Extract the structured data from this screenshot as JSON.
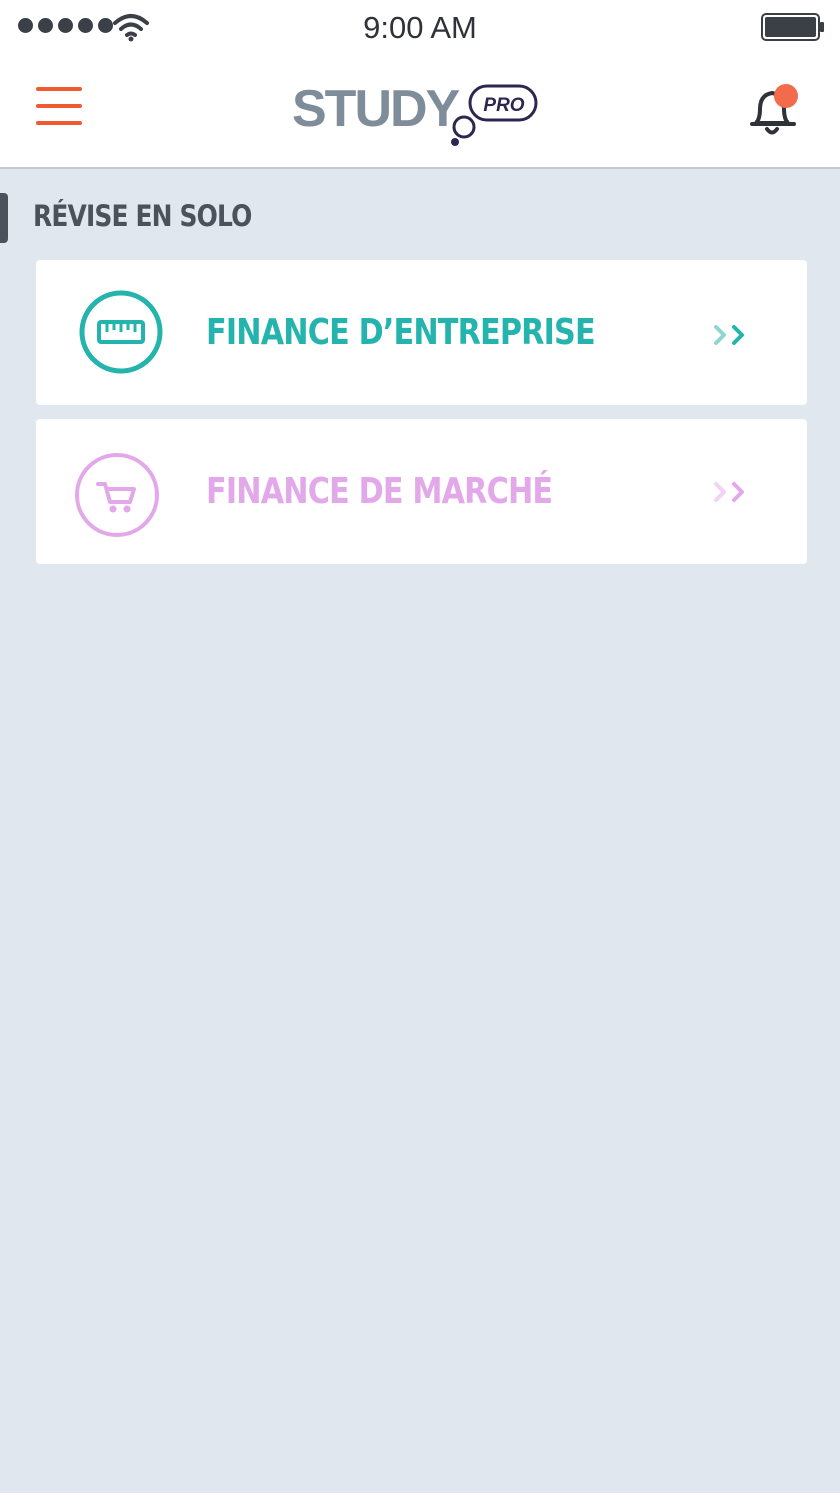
{
  "status_bar": {
    "time": "9:00 AM",
    "signal_icon": "signal-dots-icon",
    "wifi_icon": "wifi-icon",
    "battery_icon": "battery-icon"
  },
  "header": {
    "menu_icon": "hamburger-menu-icon",
    "logo_text": "STUDY",
    "logo_badge": "PRO",
    "notification_icon": "bell-icon",
    "notification_dot_color": "#f26b4a"
  },
  "section": {
    "title": "RÉVISE EN SOLO"
  },
  "cards": [
    {
      "label": "FINANCE D’ENTREPRISE",
      "icon": "ruler-icon",
      "color": "#25b4ad",
      "chevron": "double-chevron-right-icon"
    },
    {
      "label": "FINANCE DE MARCHÉ",
      "icon": "shopping-cart-icon",
      "color": "#e3a8ea",
      "chevron": "double-chevron-right-icon"
    }
  ],
  "colors": {
    "accent": "#f05a31",
    "background": "#e1e7ef",
    "text_dark": "#4c525b"
  }
}
